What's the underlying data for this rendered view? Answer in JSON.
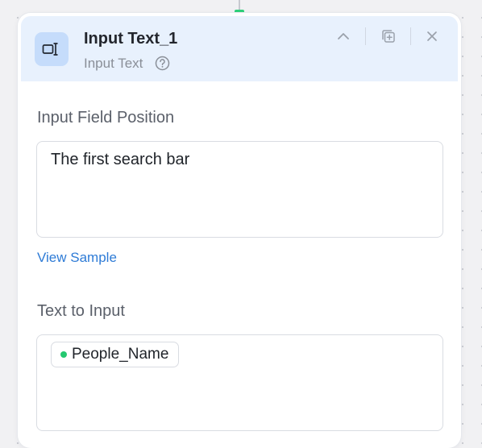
{
  "node": {
    "title": "Input Text_1",
    "subtitle": "Input Text",
    "icon": "input-text-icon",
    "accent_color": "#2fd07a"
  },
  "header_actions": [
    "collapse-icon",
    "duplicate-icon",
    "close-icon"
  ],
  "fields": {
    "position": {
      "label": "Input Field Position",
      "value": "The first search bar"
    },
    "view_sample": "View Sample",
    "text_to_input": {
      "label": "Text to Input",
      "variable": {
        "name": "People_Name",
        "status_color": "#24c870"
      }
    }
  }
}
